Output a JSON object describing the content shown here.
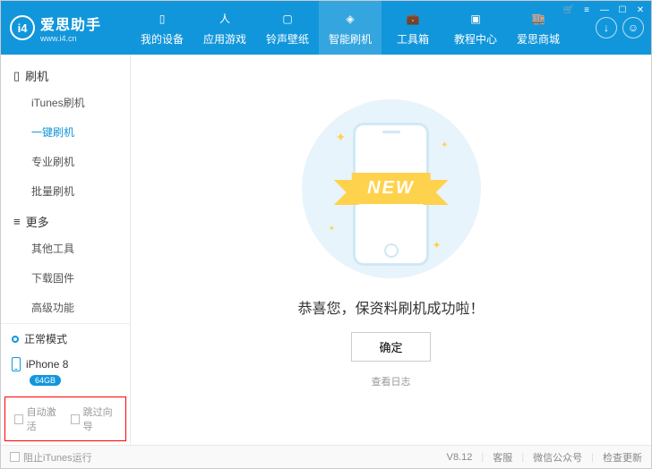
{
  "header": {
    "brand": "爱思助手",
    "domain": "www.i4.cn",
    "tabs": [
      {
        "label": "我的设备"
      },
      {
        "label": "应用游戏"
      },
      {
        "label": "铃声壁纸"
      },
      {
        "label": "智能刷机",
        "active": true
      },
      {
        "label": "工具箱"
      },
      {
        "label": "教程中心"
      },
      {
        "label": "爱思商城"
      }
    ]
  },
  "sidebar": {
    "groups": [
      {
        "title": "刷机",
        "items": [
          {
            "label": "iTunes刷机"
          },
          {
            "label": "一键刷机",
            "active": true
          },
          {
            "label": "专业刷机"
          },
          {
            "label": "批量刷机"
          }
        ]
      },
      {
        "title": "更多",
        "items": [
          {
            "label": "其他工具"
          },
          {
            "label": "下载固件"
          },
          {
            "label": "高级功能"
          }
        ]
      }
    ],
    "status_label": "正常模式",
    "device_name": "iPhone 8",
    "device_storage": "64GB",
    "auto_activate_label": "自动激活",
    "skip_guide_label": "跳过向导"
  },
  "main": {
    "ribbon_text": "NEW",
    "message": "恭喜您，保资料刷机成功啦！",
    "confirm_label": "确定",
    "log_link": "查看日志"
  },
  "footer": {
    "block_itunes_label": "阻止iTunes运行",
    "version": "V8.12",
    "links": [
      "客服",
      "微信公众号",
      "检查更新"
    ]
  }
}
